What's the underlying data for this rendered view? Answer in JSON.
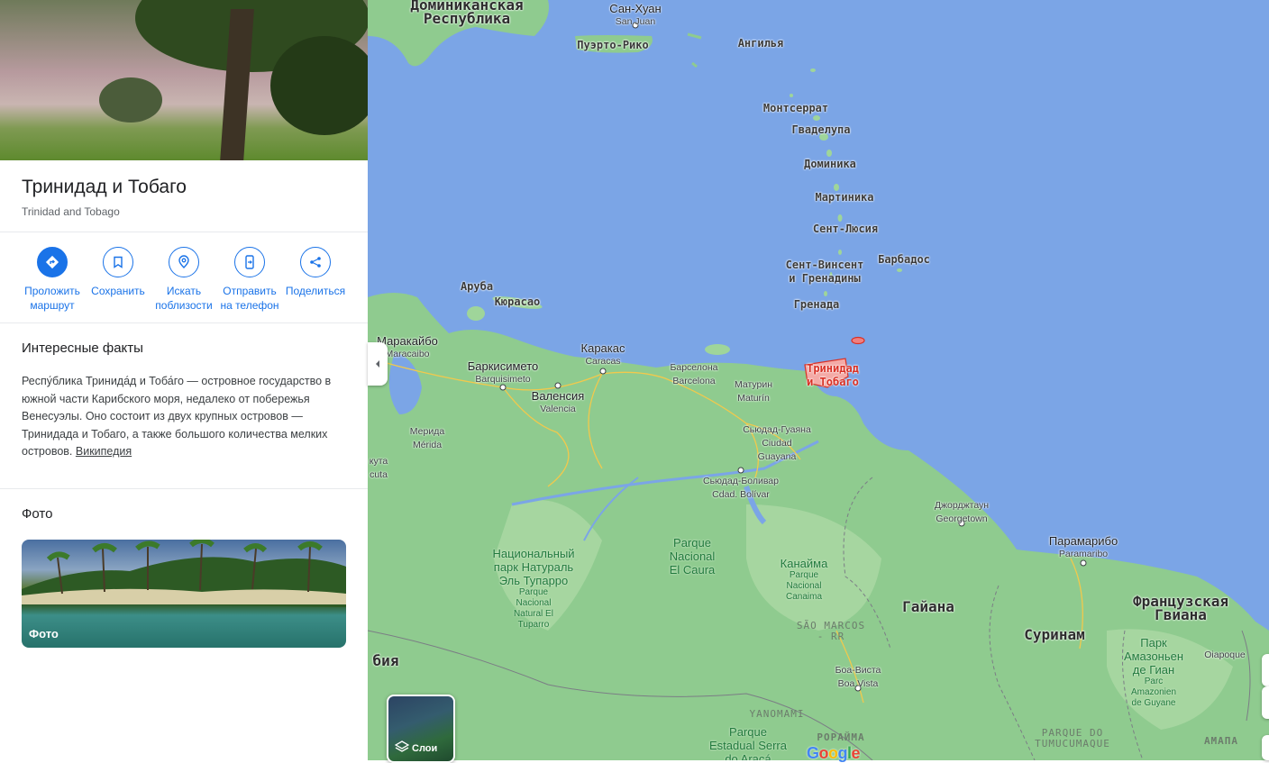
{
  "panel": {
    "title": "Тринидад и Тобаго",
    "subtitle": "Trinidad and Tobago",
    "actions": [
      {
        "label": "Проложить маршрут",
        "icon": "directions-icon"
      },
      {
        "label": "Сохранить",
        "icon": "bookmark-icon"
      },
      {
        "label": "Искать поблизости",
        "icon": "nearby-search-icon"
      },
      {
        "label": "Отправить на телефон",
        "icon": "send-to-phone-icon"
      },
      {
        "label": "Поделиться",
        "icon": "share-icon"
      }
    ],
    "facts_heading": "Интересные факты",
    "facts_text": "Респу́блика Тринида́д и Тоба́го — островное государство в южной части Карибского моря, недалеко от побережья Венесуэлы. Оно состоит из двух крупных островов — Тринидада и Тобаго, а также большого количества мелких островов.",
    "facts_link": "Википедия",
    "photos_heading": "Фото",
    "photo_label": "Фото"
  },
  "map": {
    "layers_label": "Слои",
    "google_logo": "Google",
    "highlight": {
      "line1": "Тринидад",
      "line2": "и Тобаго"
    },
    "countries": {
      "dominican": {
        "line1": "Доминиканская",
        "line2": "Республика"
      },
      "guyana": "Гайана",
      "suriname": "Суринам",
      "french_guiana": {
        "line1": "Французская",
        "line2": "Гвиана"
      },
      "colombia_partial": "бия"
    },
    "islands": {
      "puerto_rico": "Пуэрто-Рико",
      "anguilla": "Ангилья",
      "montserrat": "Монтсеррат",
      "guadeloupe": "Гваделупа",
      "dominica": "Доминика",
      "martinique": "Мартиника",
      "st_lucia": "Сент-Люсия",
      "barbados": "Барбадос",
      "st_vincent": {
        "line1": "Сент-Винсент",
        "line2": "и Гренадины"
      },
      "grenada": "Гренада",
      "aruba": "Аруба",
      "curacao": "Кюрасао"
    },
    "cities": {
      "san_juan": {
        "ru": "Сан-Хуан",
        "en": "San Juan"
      },
      "maracaibo": {
        "ru": "Маракайбо",
        "en": "Maracaibo"
      },
      "barquisimeto": {
        "ru": "Баркисимето",
        "en": "Barquisimeto"
      },
      "caracas": {
        "ru": "Каракас",
        "en": "Caracas"
      },
      "valencia": {
        "ru": "Валенсия",
        "en": "Valencia"
      },
      "barcelona": {
        "ru": "Барселона",
        "en": "Barcelona"
      },
      "maturin": {
        "ru": "Матурин",
        "en": "Maturín"
      },
      "merida": {
        "ru": "Мерида",
        "en": "Mérida"
      },
      "ciudad_guayana": {
        "ru": "Сьюдад-Гуаяна",
        "en1": "Ciudad",
        "en2": "Guayana"
      },
      "ciudad_bolivar": {
        "ru": "Сьюдад-Боливар",
        "en": "Cdad. Bolívar"
      },
      "georgetown": {
        "ru": "Джорджтаун",
        "en": "Georgetown"
      },
      "paramaribo": {
        "ru": "Парамарибо",
        "en": "Paramaribo"
      },
      "boa_vista": {
        "ru": "Боа-Виста",
        "en": "Boa Vista"
      },
      "cucuta_partial": {
        "ru": "кута",
        "en": "cuta"
      }
    },
    "parks": {
      "tuparro": {
        "l1": "Национальный",
        "l2": "парк Натураль",
        "l3": "Эль Тупарро",
        "s1": "Parque",
        "s2": "Nacional",
        "s3": "Natural El",
        "s4": "Tuparro"
      },
      "el_caura": {
        "l1": "Parque",
        "l2": "Nacional",
        "l3": "El Caura"
      },
      "canaima": {
        "l1": "Канайма",
        "s1": "Parque",
        "s2": "Nacional",
        "s3": "Canaima"
      },
      "amazonien": {
        "l1": "Парк",
        "l2": "Амазоньен",
        "l3": "де Гиан",
        "s1": "Parc",
        "s2": "Amazonien",
        "s3": "de Guyane"
      },
      "serra": {
        "l1": "Parque",
        "l2": "Estadual Serra",
        "l3": "do Aracá"
      }
    },
    "regions": {
      "sao_marcos": {
        "l1": "SÃO MARCOS",
        "l2": "- RR"
      },
      "yanomami": "YANOMAMI",
      "tumucumaque": {
        "l1": "PARQUE DO",
        "l2": "TUMUCUMAQUE"
      },
      "roraima": "РОРАЙМА",
      "amapa": "АМАПА",
      "oiapoque": "Oiapoque"
    }
  }
}
